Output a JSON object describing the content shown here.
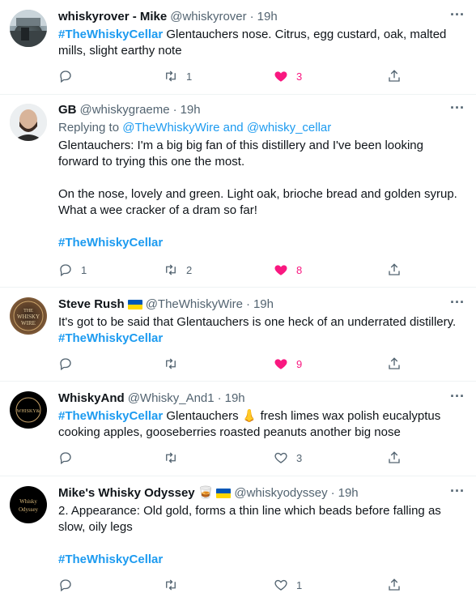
{
  "tweets": [
    {
      "name": "whiskyrover - Mike",
      "handle": "@whiskyrover",
      "time": "19h",
      "hashtag": "#TheWhiskyCellar",
      "text": " Glentauchers nose. Citrus, egg custard, oak, malted mills, slight earthy note",
      "reply_count": "",
      "retweet_count": "1",
      "like_count": "3",
      "liked": true
    },
    {
      "name": "GB",
      "handle": "@whiskygraeme",
      "time": "19h",
      "replying_prefix": "Replying to ",
      "replying_to_1": "@TheWhiskyWire",
      "replying_and": " and ",
      "replying_to_2": "@whisky_cellar",
      "para1": "Glentauchers: I'm a big big fan of this distillery and I've been looking forward to trying this one the most.",
      "para2": "On the nose, lovely and green. Light oak, brioche bread and golden syrup. What a wee cracker of a dram so far!",
      "hashtag": "#TheWhiskyCellar",
      "reply_count": "1",
      "retweet_count": "2",
      "like_count": "8",
      "liked": true
    },
    {
      "name": "Steve Rush",
      "handle": "@TheWhiskyWire",
      "time": "19h",
      "text": "It's got to be said that Glentauchers is one heck of an underrated distillery.",
      "hashtag": "#TheWhiskyCellar",
      "reply_count": "",
      "retweet_count": "",
      "like_count": "9",
      "liked": true,
      "avatar_text": "THE WHISKY WIRE"
    },
    {
      "name": "WhiskyAnd",
      "handle": "@Whisky_And1",
      "time": "19h",
      "hashtag": "#TheWhiskyCellar",
      "text": " Glentauchers 👃 fresh limes  wax polish eucalyptus cooking apples, gooseberries roasted peanuts  another big nose",
      "reply_count": "",
      "retweet_count": "",
      "like_count": "3",
      "liked": false,
      "avatar_text": "WHISKY&"
    },
    {
      "name": "Mike's Whisky Odyssey",
      "emoji": "🥃",
      "handle": "@whiskyodyssey",
      "time": "19h",
      "text": "2. Appearance: Old gold, forms a thin line which beads before falling as slow, oily legs",
      "hashtag": "#TheWhiskyCellar",
      "reply_count": "",
      "retweet_count": "",
      "like_count": "1",
      "liked": false,
      "avatar_text": "Whisky Odyssey"
    }
  ],
  "more_icon": "···",
  "colors": {
    "link": "#1d9bf0",
    "like_active": "#f91880",
    "muted": "#536471",
    "divider": "#eff3f4"
  }
}
